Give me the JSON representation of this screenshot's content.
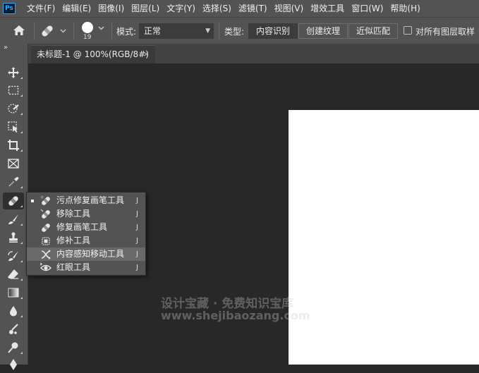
{
  "app": {
    "logo_text": "Ps"
  },
  "menubar": {
    "items": [
      "文件(F)",
      "编辑(E)",
      "图像(I)",
      "图层(L)",
      "文字(Y)",
      "选择(S)",
      "滤镜(T)",
      "视图(V)",
      "增效工具",
      "窗口(W)",
      "帮助(H)"
    ]
  },
  "options": {
    "brush_size": "19",
    "mode_label": "模式:",
    "mode_value": "正常",
    "type_label": "类型:",
    "type_buttons": [
      "内容识别",
      "创建纹理",
      "近似匹配"
    ],
    "active_type": "内容识别",
    "sample_all_layers_label": "对所有图层取样",
    "sample_all_layers_checked": false
  },
  "panel": {
    "collapse_icon": "»"
  },
  "document_tab": {
    "title": "未标题-1 @ 100%(RGB/8#)",
    "close_glyph": "×"
  },
  "toolbar": {
    "tools": [
      "move-icon",
      "marquee-icon",
      "quick-select-icon",
      "object-select-icon",
      "crop-icon",
      "frame-icon",
      "eyedropper-icon",
      "spot-healing-icon",
      "brush-icon",
      "stamp-icon",
      "history-brush-icon",
      "eraser-icon",
      "gradient-icon",
      "blur-icon",
      "dodge-icon",
      "burn-icon",
      "pen-icon"
    ],
    "active_tool": "spot-healing-icon"
  },
  "flyout": {
    "items": [
      {
        "label": "污点修复画笔工具",
        "shortcut": "J",
        "icon": "spot-healing-brush-icon",
        "selected": true
      },
      {
        "label": "移除工具",
        "shortcut": "J",
        "icon": "remove-tool-icon",
        "selected": false
      },
      {
        "label": "修复画笔工具",
        "shortcut": "J",
        "icon": "healing-brush-icon",
        "selected": false
      },
      {
        "label": "修补工具",
        "shortcut": "J",
        "icon": "patch-tool-icon",
        "selected": false
      },
      {
        "label": "内容感知移动工具",
        "shortcut": "J",
        "icon": "content-aware-move-icon",
        "selected": false,
        "highlighted": true
      },
      {
        "label": "红眼工具",
        "shortcut": "J",
        "icon": "red-eye-icon",
        "selected": false
      }
    ]
  },
  "watermark": {
    "line1": "设计宝藏 · 免费知识宝库",
    "line2": "www.shejibaozang.com"
  },
  "colors": {
    "chrome": "#535353",
    "canvas_bg": "#282828",
    "document": "#ffffff",
    "accent": "#31a8ff",
    "highlight": "#696969"
  }
}
